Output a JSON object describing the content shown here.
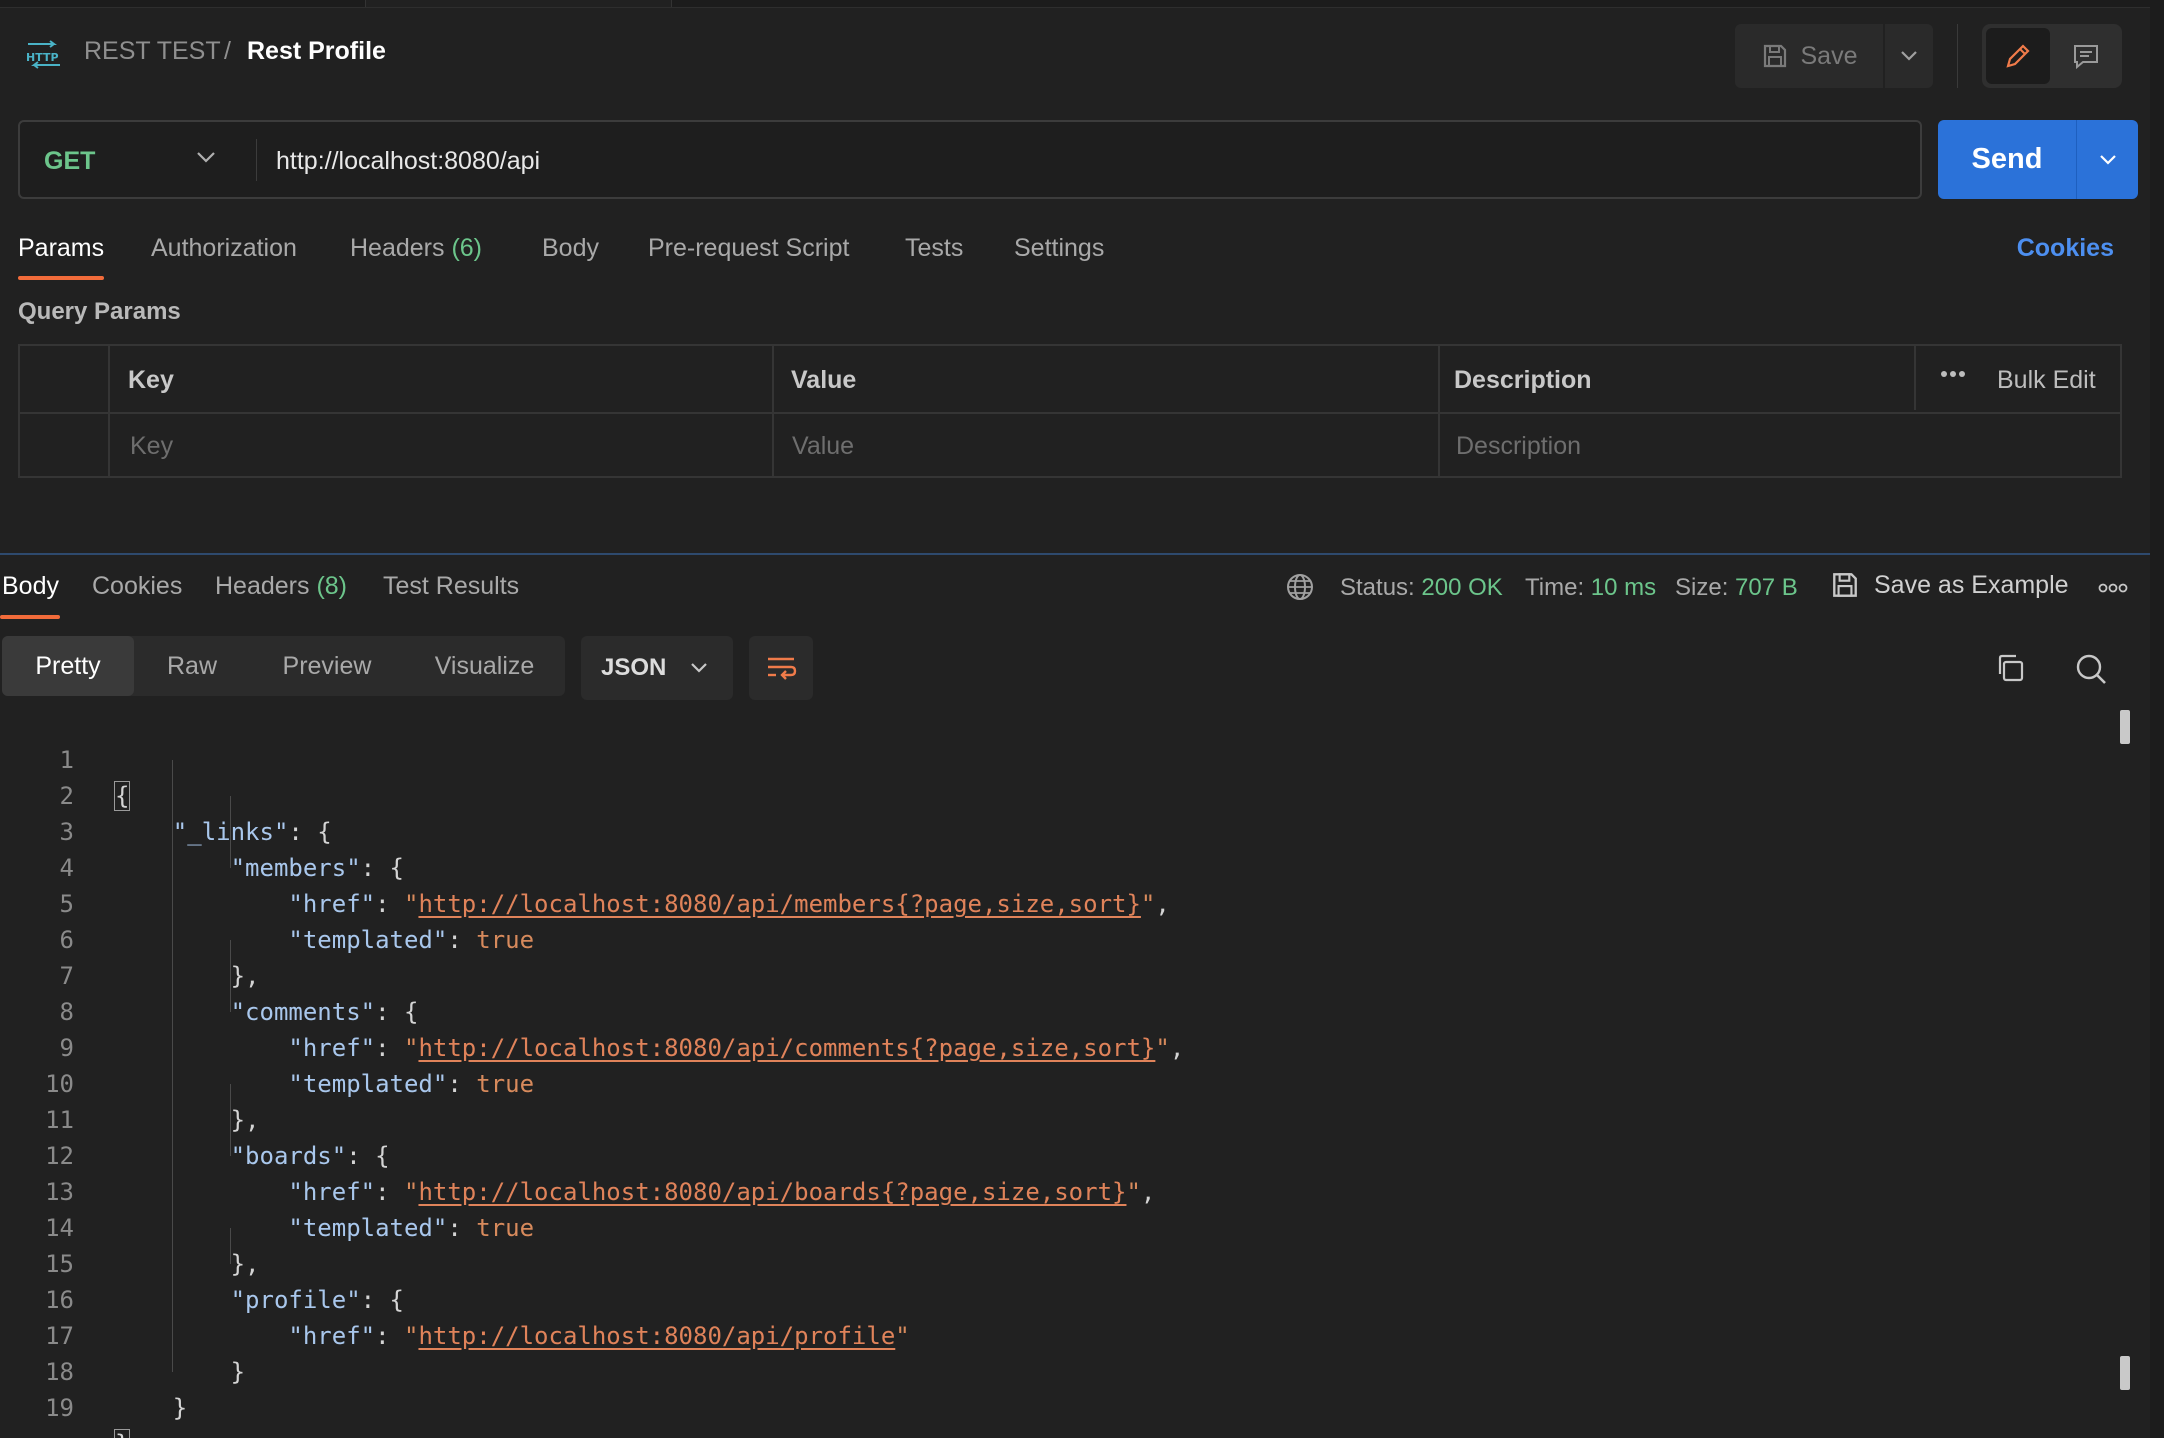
{
  "header": {
    "collection": "REST TEST",
    "separator": "/",
    "request_name": "Rest Profile",
    "save_label": "Save"
  },
  "request": {
    "method": "GET",
    "url": "http://localhost:8080/api",
    "send_label": "Send"
  },
  "request_tabs": {
    "params": "Params",
    "authorization": "Authorization",
    "headers": "Headers",
    "headers_count": "(6)",
    "body": "Body",
    "prerequest": "Pre-request Script",
    "tests": "Tests",
    "settings": "Settings",
    "cookies": "Cookies"
  },
  "query_params": {
    "title": "Query Params",
    "columns": {
      "key": "Key",
      "value": "Value",
      "description": "Description"
    },
    "placeholders": {
      "key": "Key",
      "value": "Value",
      "description": "Description"
    },
    "bulk_edit": "Bulk Edit"
  },
  "response_tabs": {
    "body": "Body",
    "cookies": "Cookies",
    "headers": "Headers",
    "headers_count": "(8)",
    "test_results": "Test Results"
  },
  "response_status": {
    "status_label": "Status:",
    "status_value": "200 OK",
    "time_label": "Time:",
    "time_value": "10 ms",
    "size_label": "Size:",
    "size_value": "707 B",
    "save_example": "Save as Example"
  },
  "view_modes": {
    "pretty": "Pretty",
    "raw": "Raw",
    "preview": "Preview",
    "visualize": "Visualize",
    "format": "JSON"
  },
  "code": {
    "line_numbers": [
      "1",
      "2",
      "3",
      "4",
      "5",
      "6",
      "7",
      "8",
      "9",
      "10",
      "11",
      "12",
      "13",
      "14",
      "15",
      "16",
      "17",
      "18",
      "19"
    ],
    "open_brace": "{",
    "close_brace": "}",
    "links_key": "\"_links\"",
    "members_key": "\"members\"",
    "comments_key": "\"comments\"",
    "boards_key": "\"boards\"",
    "profile_key": "\"profile\"",
    "href_key": "\"href\"",
    "templated_key": "\"templated\"",
    "true_value": "true",
    "members_url": "http://localhost:8080/api/members{?page,size,sort}",
    "comments_url": "http://localhost:8080/api/comments{?page,size,sort}",
    "boards_url": "http://localhost:8080/api/boards{?page,size,sort}",
    "profile_url": "http://localhost:8080/api/profile"
  },
  "colors": {
    "accent_orange": "#f26b3a",
    "send_blue": "#2b72d9",
    "success_green": "#6cc58b",
    "link_blue": "#4d8ff0"
  }
}
